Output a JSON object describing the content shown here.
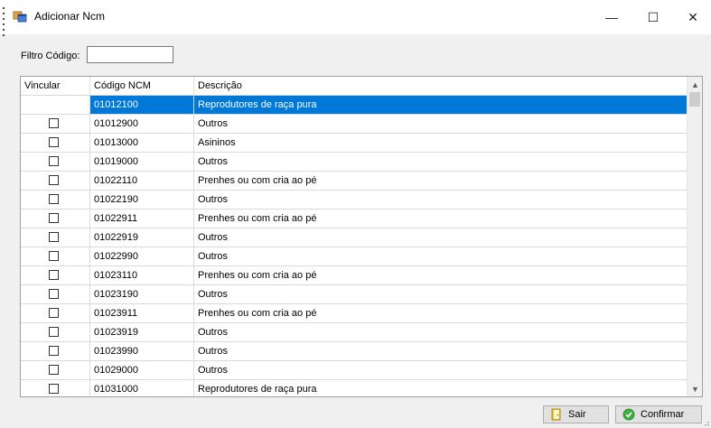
{
  "window": {
    "title": "Adicionar Ncm",
    "minimize_glyph": "—",
    "maximize_glyph": "☐",
    "close_glyph": "✕",
    "icon": "app-window-icon"
  },
  "filter": {
    "label": "Filtro Código:",
    "value": ""
  },
  "grid": {
    "columns": [
      "Vincular",
      "Código NCM",
      "Descrição"
    ],
    "rows": [
      {
        "checked": false,
        "code": "01012100",
        "desc": "Reprodutores de raça pura",
        "selected": true
      },
      {
        "checked": false,
        "code": "01012900",
        "desc": "Outros",
        "selected": false
      },
      {
        "checked": false,
        "code": "01013000",
        "desc": "Asininos",
        "selected": false
      },
      {
        "checked": false,
        "code": "01019000",
        "desc": "Outros",
        "selected": false
      },
      {
        "checked": false,
        "code": "01022110",
        "desc": "Prenhes ou com cria ao pé",
        "selected": false
      },
      {
        "checked": false,
        "code": "01022190",
        "desc": "Outros",
        "selected": false
      },
      {
        "checked": false,
        "code": "01022911",
        "desc": "Prenhes ou com cria ao pé",
        "selected": false
      },
      {
        "checked": false,
        "code": "01022919",
        "desc": "Outros",
        "selected": false
      },
      {
        "checked": false,
        "code": "01022990",
        "desc": "Outros",
        "selected": false
      },
      {
        "checked": false,
        "code": "01023110",
        "desc": "Prenhes ou com cria ao pé",
        "selected": false
      },
      {
        "checked": false,
        "code": "01023190",
        "desc": "Outros",
        "selected": false
      },
      {
        "checked": false,
        "code": "01023911",
        "desc": "Prenhes ou com cria ao pé",
        "selected": false
      },
      {
        "checked": false,
        "code": "01023919",
        "desc": "Outros",
        "selected": false
      },
      {
        "checked": false,
        "code": "01023990",
        "desc": "Outros",
        "selected": false
      },
      {
        "checked": false,
        "code": "01029000",
        "desc": "Outros",
        "selected": false
      },
      {
        "checked": false,
        "code": "01031000",
        "desc": "Reprodutores de raça pura",
        "selected": false
      }
    ],
    "scroll_up_glyph": "▲",
    "scroll_down_glyph": "▼"
  },
  "buttons": {
    "exit_label": "Sair",
    "exit_icon": "exit-door-icon",
    "confirm_label": "Confirmar",
    "confirm_icon": "check-circle-icon"
  },
  "colors": {
    "selection": "#0078d7",
    "confirm_icon": "#3cb043",
    "exit_icon": "#d9a300"
  }
}
